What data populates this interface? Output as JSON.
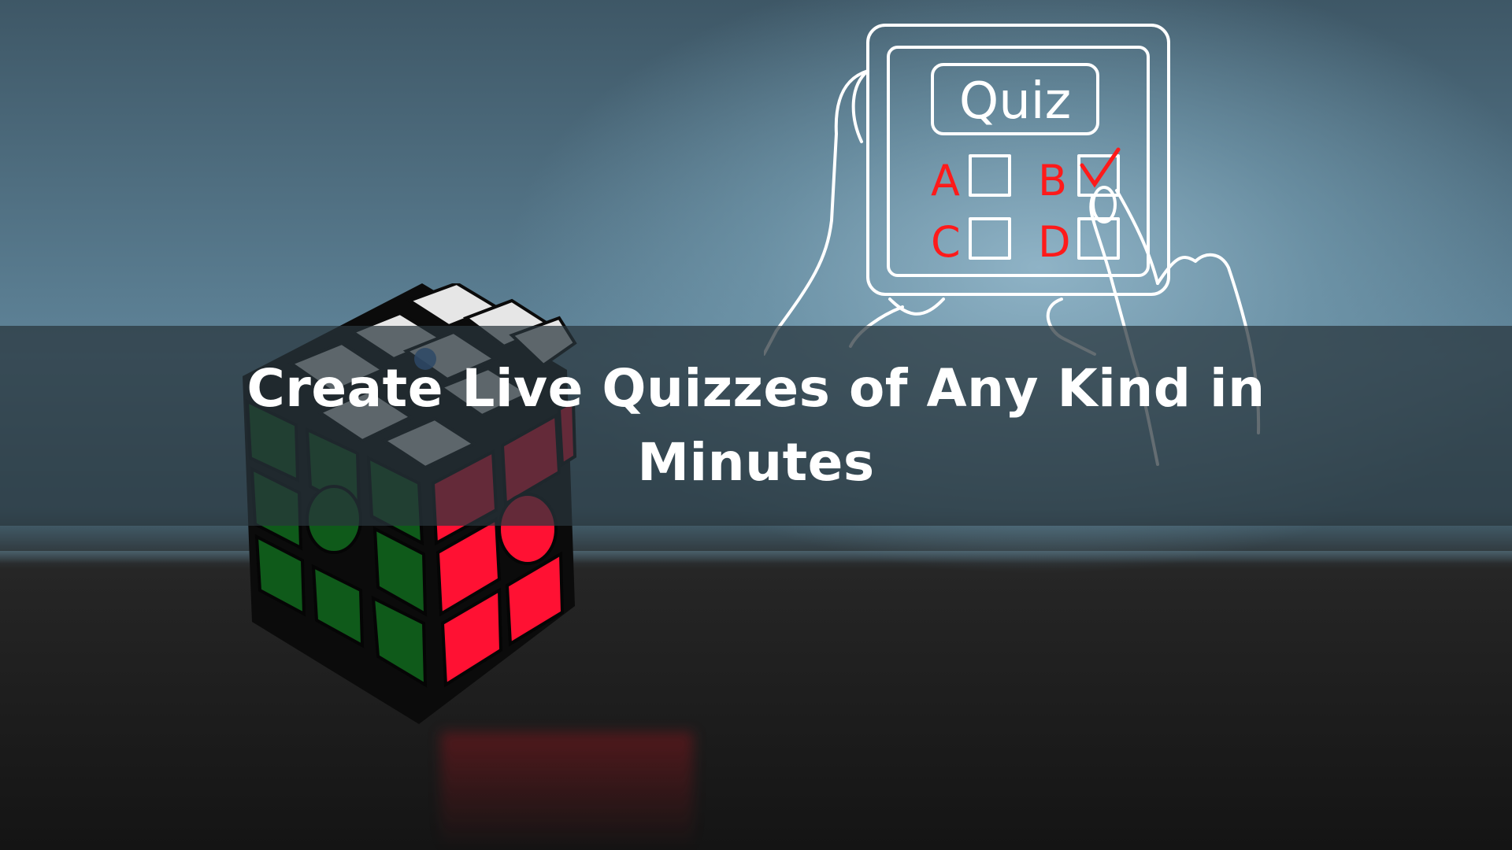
{
  "headline": "Create Live Quizzes of Any Kind in Minutes",
  "illustration": {
    "title": "Quiz",
    "options": [
      "A",
      "B",
      "C",
      "D"
    ],
    "selected_option": "B"
  },
  "colors": {
    "overlay": "#28343c",
    "headline_text": "#ffffff",
    "cube_red": "#ff1133",
    "cube_green": "#0f5a1a",
    "cube_white": "#e6e6e6",
    "quiz_line": "#ffffff",
    "quiz_accent": "#ff1a1a"
  }
}
